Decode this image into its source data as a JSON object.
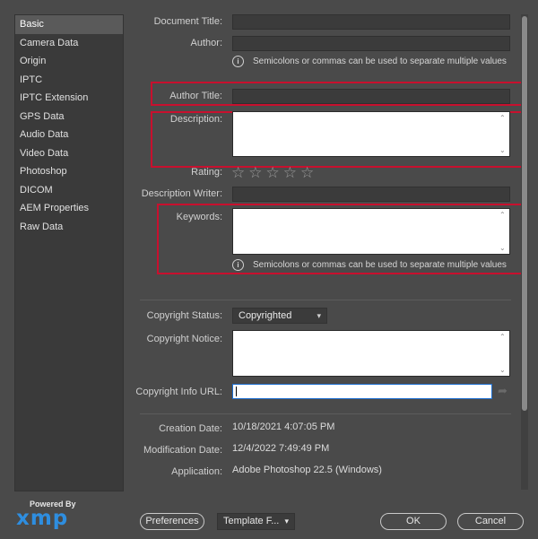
{
  "sidebar": {
    "items": [
      {
        "label": "Basic",
        "selected": true
      },
      {
        "label": "Camera Data"
      },
      {
        "label": "Origin"
      },
      {
        "label": "IPTC"
      },
      {
        "label": "IPTC Extension"
      },
      {
        "label": "GPS Data"
      },
      {
        "label": "Audio Data"
      },
      {
        "label": "Video Data"
      },
      {
        "label": "Photoshop"
      },
      {
        "label": "DICOM"
      },
      {
        "label": "AEM Properties"
      },
      {
        "label": "Raw Data"
      }
    ]
  },
  "branding": {
    "powered_by": "Powered By",
    "logo": "xmp",
    "logo_color": "#2e8ee0"
  },
  "form": {
    "document_title_label": "Document Title:",
    "author_label": "Author:",
    "author_hint": "Semicolons or commas can be used to separate multiple values",
    "author_title_label": "Author Title:",
    "description_label": "Description:",
    "rating_label": "Rating:",
    "rating_value": 0,
    "rating_max": 5,
    "description_writer_label": "Description Writer:",
    "keywords_label": "Keywords:",
    "keywords_hint": "Semicolons or commas can be used to separate multiple values",
    "copyright_status_label": "Copyright Status:",
    "copyright_status_value": "Copyrighted",
    "copyright_notice_label": "Copyright Notice:",
    "copyright_url_label": "Copyright Info URL:",
    "creation_date_label": "Creation Date:",
    "creation_date_value": "10/18/2021 4:07:05 PM",
    "modification_date_label": "Modification Date:",
    "modification_date_value": "12/4/2022 7:49:49 PM",
    "application_label": "Application:",
    "application_value": "Adobe Photoshop 22.5 (Windows)"
  },
  "footer": {
    "preferences_label": "Preferences",
    "template_label": "Template F...",
    "ok_label": "OK",
    "cancel_label": "Cancel"
  },
  "icons": {
    "info": "info-icon",
    "star": "star-icon",
    "chevron": "chevron-down-icon",
    "arrow": "arrow-right-icon"
  },
  "highlight_color": "#c8102e"
}
